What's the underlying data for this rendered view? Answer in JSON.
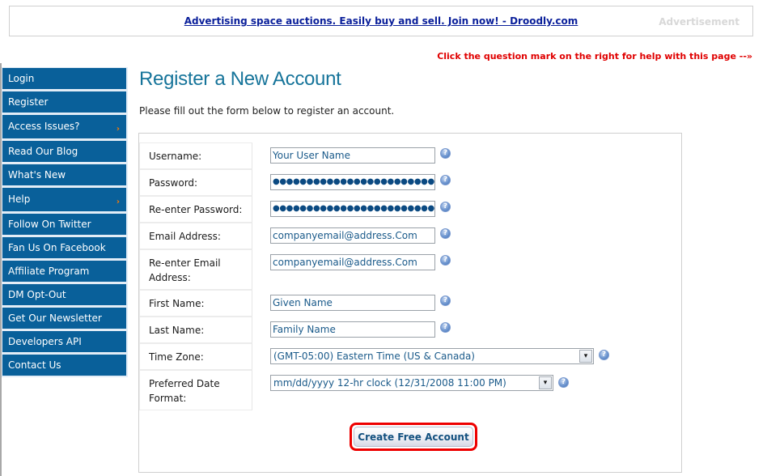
{
  "ad": {
    "link_text": "Advertising space auctions. Easily buy and sell. Join now! - Droodly.com",
    "label": "Advertisement"
  },
  "help_hint": "Click the question mark on the right for help with this page --»",
  "sidebar": {
    "items": [
      {
        "label": "Login",
        "has_submenu": false
      },
      {
        "label": "Register",
        "has_submenu": false
      },
      {
        "label": "Access Issues?",
        "has_submenu": true
      },
      {
        "label": "Read Our Blog",
        "has_submenu": false
      },
      {
        "label": "What's New",
        "has_submenu": false
      },
      {
        "label": "Help",
        "has_submenu": true
      },
      {
        "label": "Follow On Twitter",
        "has_submenu": false
      },
      {
        "label": "Fan Us On Facebook",
        "has_submenu": false
      },
      {
        "label": "Affiliate Program",
        "has_submenu": false
      },
      {
        "label": "DM Opt-Out",
        "has_submenu": false
      },
      {
        "label": "Get Our Newsletter",
        "has_submenu": false
      },
      {
        "label": "Developers API",
        "has_submenu": false
      },
      {
        "label": "Contact Us",
        "has_submenu": false
      }
    ],
    "submenu_glyph": "›"
  },
  "page": {
    "title": "Register a New Account",
    "intro": "Please fill out the form below to register an account."
  },
  "form": {
    "username": {
      "label": "Username:",
      "value": "Your User Name"
    },
    "password": {
      "label": "Password:",
      "value": "●●●●●●●●●●●●●●●●●●●●●●●●●●●●●●"
    },
    "password_confirm": {
      "label": "Re-enter Password:",
      "value": "●●●●●●●●●●●●●●●●●●●●●●●●●●●●●●"
    },
    "email": {
      "label": "Email Address:",
      "value": "companyemail@address.Com"
    },
    "email_confirm": {
      "label_line1": "Re-enter Email",
      "label_line2": "Address:",
      "value": "companyemail@address.Com"
    },
    "first_name": {
      "label": "First Name:",
      "value": "Given Name"
    },
    "last_name": {
      "label": "Last Name:",
      "value": "Family Name"
    },
    "time_zone": {
      "label": "Time Zone:",
      "selected": "(GMT-05:00) Eastern Time (US & Canada)"
    },
    "date_format": {
      "label_line1": "Preferred Date",
      "label_line2": "Format:",
      "selected": "mm/dd/yyyy 12-hr clock (12/31/2008 11:00 PM)"
    },
    "help_glyph": "?",
    "dropdown_glyph": "▾",
    "submit_label": "Create Free Account"
  },
  "colors": {
    "nav_bg": "#09609a",
    "title": "#16749a",
    "hint": "#e00000",
    "highlight_ring": "#ee0000"
  }
}
